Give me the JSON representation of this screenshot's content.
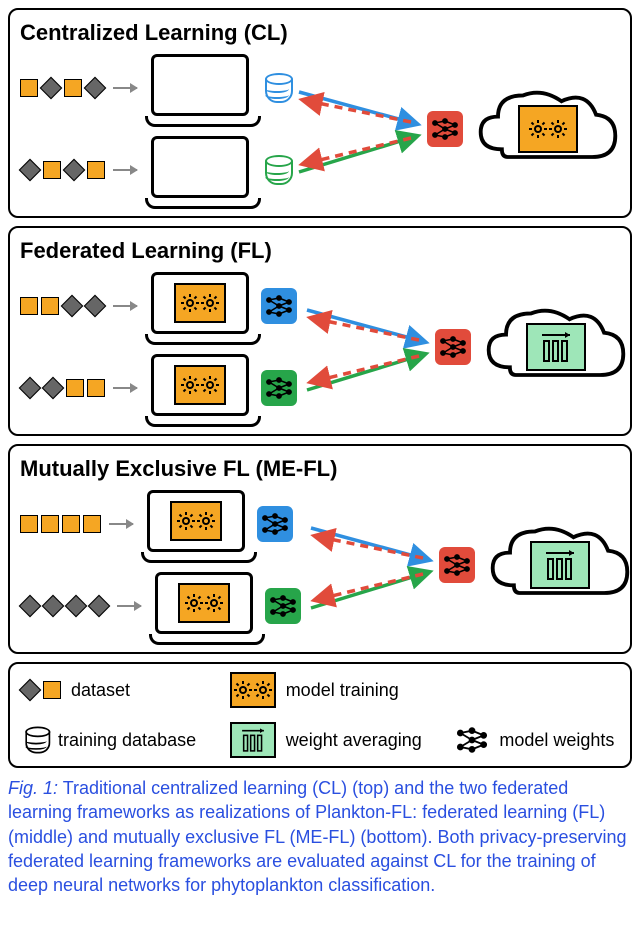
{
  "panels": {
    "cl": {
      "title": "Centralized Learning (CL)"
    },
    "fl": {
      "title": "Federated Learning (FL)"
    },
    "mefl": {
      "title": "Mutually Exclusive FL (ME-FL)"
    }
  },
  "legend": {
    "dataset": "dataset",
    "training_database": "training database",
    "model_training": "model training",
    "weight_averaging": "weight averaging",
    "model_weights": "model weights"
  },
  "caption": {
    "fig_label": "Fig. 1:",
    "text": " Traditional centralized learning (CL) (top) and the two federated learning frameworks as realizations of Plankton-FL: federated learning (FL) (middle) and mutually exclusive FL (ME-FL) (bottom). Both privacy-preserving federated learning frameworks are evaluated against CL for the training of deep neural networks for phytoplankton classification."
  },
  "icons": {
    "dataset_square": "dataset-square",
    "dataset_diamond": "dataset-diamond",
    "laptop": "laptop",
    "database": "database",
    "network": "network",
    "gears": "gears",
    "averaging": "averaging",
    "cloud": "cloud"
  },
  "colors": {
    "orange": "#f5a623",
    "blue": "#2f8fe0",
    "green": "#27a54a",
    "red": "#e14b3b",
    "mint": "#9ee6b8",
    "gray": "#666"
  }
}
